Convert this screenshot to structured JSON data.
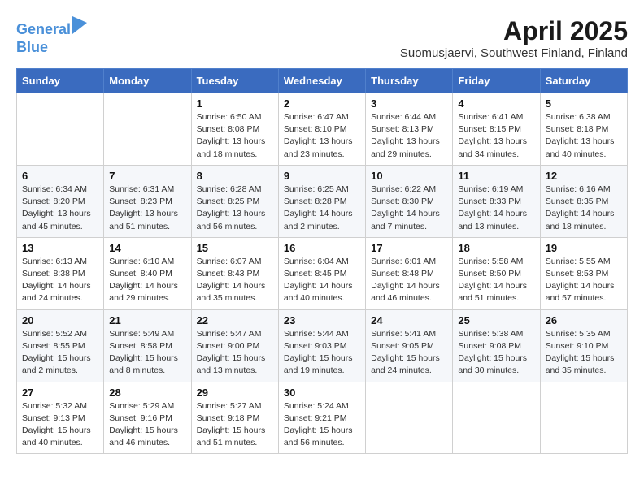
{
  "header": {
    "logo_line1": "General",
    "logo_line2": "Blue",
    "month_title": "April 2025",
    "location": "Suomusjaervi, Southwest Finland, Finland"
  },
  "days_of_week": [
    "Sunday",
    "Monday",
    "Tuesday",
    "Wednesday",
    "Thursday",
    "Friday",
    "Saturday"
  ],
  "weeks": [
    [
      {
        "day": "",
        "info": ""
      },
      {
        "day": "",
        "info": ""
      },
      {
        "day": "1",
        "info": "Sunrise: 6:50 AM\nSunset: 8:08 PM\nDaylight: 13 hours and 18 minutes."
      },
      {
        "day": "2",
        "info": "Sunrise: 6:47 AM\nSunset: 8:10 PM\nDaylight: 13 hours and 23 minutes."
      },
      {
        "day": "3",
        "info": "Sunrise: 6:44 AM\nSunset: 8:13 PM\nDaylight: 13 hours and 29 minutes."
      },
      {
        "day": "4",
        "info": "Sunrise: 6:41 AM\nSunset: 8:15 PM\nDaylight: 13 hours and 34 minutes."
      },
      {
        "day": "5",
        "info": "Sunrise: 6:38 AM\nSunset: 8:18 PM\nDaylight: 13 hours and 40 minutes."
      }
    ],
    [
      {
        "day": "6",
        "info": "Sunrise: 6:34 AM\nSunset: 8:20 PM\nDaylight: 13 hours and 45 minutes."
      },
      {
        "day": "7",
        "info": "Sunrise: 6:31 AM\nSunset: 8:23 PM\nDaylight: 13 hours and 51 minutes."
      },
      {
        "day": "8",
        "info": "Sunrise: 6:28 AM\nSunset: 8:25 PM\nDaylight: 13 hours and 56 minutes."
      },
      {
        "day": "9",
        "info": "Sunrise: 6:25 AM\nSunset: 8:28 PM\nDaylight: 14 hours and 2 minutes."
      },
      {
        "day": "10",
        "info": "Sunrise: 6:22 AM\nSunset: 8:30 PM\nDaylight: 14 hours and 7 minutes."
      },
      {
        "day": "11",
        "info": "Sunrise: 6:19 AM\nSunset: 8:33 PM\nDaylight: 14 hours and 13 minutes."
      },
      {
        "day": "12",
        "info": "Sunrise: 6:16 AM\nSunset: 8:35 PM\nDaylight: 14 hours and 18 minutes."
      }
    ],
    [
      {
        "day": "13",
        "info": "Sunrise: 6:13 AM\nSunset: 8:38 PM\nDaylight: 14 hours and 24 minutes."
      },
      {
        "day": "14",
        "info": "Sunrise: 6:10 AM\nSunset: 8:40 PM\nDaylight: 14 hours and 29 minutes."
      },
      {
        "day": "15",
        "info": "Sunrise: 6:07 AM\nSunset: 8:43 PM\nDaylight: 14 hours and 35 minutes."
      },
      {
        "day": "16",
        "info": "Sunrise: 6:04 AM\nSunset: 8:45 PM\nDaylight: 14 hours and 40 minutes."
      },
      {
        "day": "17",
        "info": "Sunrise: 6:01 AM\nSunset: 8:48 PM\nDaylight: 14 hours and 46 minutes."
      },
      {
        "day": "18",
        "info": "Sunrise: 5:58 AM\nSunset: 8:50 PM\nDaylight: 14 hours and 51 minutes."
      },
      {
        "day": "19",
        "info": "Sunrise: 5:55 AM\nSunset: 8:53 PM\nDaylight: 14 hours and 57 minutes."
      }
    ],
    [
      {
        "day": "20",
        "info": "Sunrise: 5:52 AM\nSunset: 8:55 PM\nDaylight: 15 hours and 2 minutes."
      },
      {
        "day": "21",
        "info": "Sunrise: 5:49 AM\nSunset: 8:58 PM\nDaylight: 15 hours and 8 minutes."
      },
      {
        "day": "22",
        "info": "Sunrise: 5:47 AM\nSunset: 9:00 PM\nDaylight: 15 hours and 13 minutes."
      },
      {
        "day": "23",
        "info": "Sunrise: 5:44 AM\nSunset: 9:03 PM\nDaylight: 15 hours and 19 minutes."
      },
      {
        "day": "24",
        "info": "Sunrise: 5:41 AM\nSunset: 9:05 PM\nDaylight: 15 hours and 24 minutes."
      },
      {
        "day": "25",
        "info": "Sunrise: 5:38 AM\nSunset: 9:08 PM\nDaylight: 15 hours and 30 minutes."
      },
      {
        "day": "26",
        "info": "Sunrise: 5:35 AM\nSunset: 9:10 PM\nDaylight: 15 hours and 35 minutes."
      }
    ],
    [
      {
        "day": "27",
        "info": "Sunrise: 5:32 AM\nSunset: 9:13 PM\nDaylight: 15 hours and 40 minutes."
      },
      {
        "day": "28",
        "info": "Sunrise: 5:29 AM\nSunset: 9:16 PM\nDaylight: 15 hours and 46 minutes."
      },
      {
        "day": "29",
        "info": "Sunrise: 5:27 AM\nSunset: 9:18 PM\nDaylight: 15 hours and 51 minutes."
      },
      {
        "day": "30",
        "info": "Sunrise: 5:24 AM\nSunset: 9:21 PM\nDaylight: 15 hours and 56 minutes."
      },
      {
        "day": "",
        "info": ""
      },
      {
        "day": "",
        "info": ""
      },
      {
        "day": "",
        "info": ""
      }
    ]
  ]
}
